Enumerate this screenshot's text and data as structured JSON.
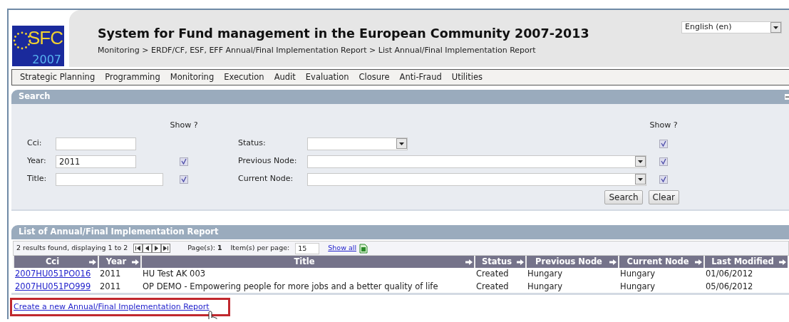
{
  "logo": {
    "text": "SFC",
    "year": "2007"
  },
  "header": {
    "title": "System for Fund management in the European Community 2007-2013",
    "breadcrumb": "Monitoring > ERDF/CF, ESF, EFF Annual/Final Implementation Report > List Annual/Final Implementation Report"
  },
  "language_select": {
    "value": "English (en)"
  },
  "menu": [
    "Strategic Planning",
    "Programming",
    "Monitoring",
    "Execution",
    "Audit",
    "Evaluation",
    "Closure",
    "Anti-Fraud",
    "Utilities"
  ],
  "search_panel": {
    "title": "Search",
    "show_heading_left": "Show ?",
    "show_heading_right": "Show ?",
    "left_fields": [
      {
        "label": "Cci:",
        "kind": "text"
      },
      {
        "label": "Year:",
        "value": "2011",
        "kind": "text",
        "show": true
      },
      {
        "label": "Title:",
        "kind": "widetext",
        "show": true
      }
    ],
    "right_fields": [
      {
        "label": "Status:",
        "kind": "select",
        "show": true
      },
      {
        "label": "Previous Node:",
        "kind": "wideselect",
        "show": true
      },
      {
        "label": "Current Node:",
        "kind": "wideselect",
        "show": true
      }
    ],
    "buttons": [
      "Search",
      "Clear"
    ]
  },
  "list_panel": {
    "title": "List of Annual/Final Implementation Report",
    "summary": "2 results found, displaying 1 to 2",
    "pages_label": "Page(s):",
    "pages_value": "1",
    "per_page_label": "Item(s) per page:",
    "per_page_value": "15",
    "show_all": "Show all",
    "columns": [
      "Cci",
      "Year",
      "Title",
      "Status",
      "Previous Node",
      "Current Node",
      "Last Modified"
    ],
    "rows": [
      [
        "2007HU051PO016",
        "2011",
        "HU Test AK 003",
        "Created",
        "Hungary",
        "Hungary",
        "01/06/2012"
      ],
      [
        "2007HU051PO999",
        "2011",
        "OP DEMO - Empowering people for more jobs and a better quality of life",
        "Created",
        "Hungary",
        "Hungary",
        "05/06/2012"
      ]
    ]
  },
  "create_link": {
    "text": "Create a new Annual/Final Implementation Report",
    "highlighted": true
  }
}
